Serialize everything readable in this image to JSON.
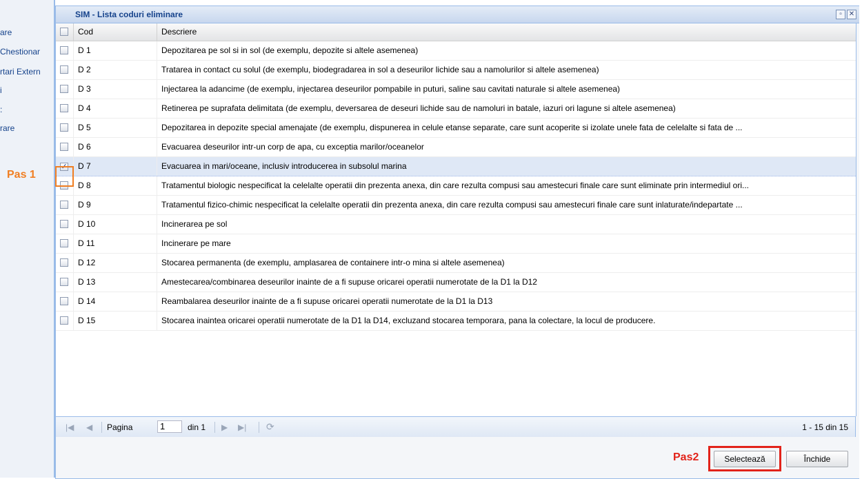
{
  "background": {
    "sidebar_items": [
      "are",
      "Chestionar",
      "rtari Extern",
      "i",
      ":",
      "rare"
    ]
  },
  "annotations": {
    "step1": "Pas 1",
    "step2": "Pas2",
    "step1_color": "#f07e22",
    "step2_color": "#e2231a"
  },
  "window": {
    "title": "SIM - Lista coduri eliminare",
    "tools": [
      "restore-icon",
      "close-icon"
    ]
  },
  "grid": {
    "columns": [
      "Cod",
      "Descriere"
    ],
    "rows": [
      {
        "cod": "D 1",
        "desc": "Depozitarea pe sol si in sol (de exemplu, depozite si altele asemenea)",
        "checked": false
      },
      {
        "cod": "D 2",
        "desc": "Tratarea in contact cu solul (de exemplu, biodegradarea in sol a deseurilor lichide sau a namolurilor si altele asemenea)",
        "checked": false
      },
      {
        "cod": "D 3",
        "desc": "Injectarea la adancime (de exemplu, injectarea deseurilor pompabile in puturi, saline sau cavitati naturale si altele asemenea)",
        "checked": false
      },
      {
        "cod": "D 4",
        "desc": "Retinerea pe suprafata delimitata (de exemplu, deversarea de deseuri lichide sau de namoluri in batale, iazuri ori lagune si altele asemenea)",
        "checked": false
      },
      {
        "cod": "D 5",
        "desc": "Depozitarea in depozite special amenajate (de exemplu, dispunerea in celule etanse separate, care sunt acoperite si izolate unele fata de celelalte si fata de ...",
        "checked": false
      },
      {
        "cod": "D 6",
        "desc": "Evacuarea deseurilor intr-un corp de apa, cu exceptia marilor/oceanelor",
        "checked": false
      },
      {
        "cod": "D 7",
        "desc": "Evacuarea in mari/oceane, inclusiv introducerea in subsolul marina",
        "checked": true
      },
      {
        "cod": "D 8",
        "desc": "Tratamentul biologic nespecificat la celelalte operatii din prezenta anexa, din care rezulta compusi sau amestecuri finale care sunt eliminate prin intermediul ori...",
        "checked": false
      },
      {
        "cod": "D 9",
        "desc": "Tratamentul fizico-chimic nespecificat la celelalte operatii din prezenta anexa, din care rezulta compusi sau amestecuri finale care sunt inlaturate/indepartate ...",
        "checked": false
      },
      {
        "cod": "D 10",
        "desc": "Incinerarea pe sol",
        "checked": false
      },
      {
        "cod": "D 11",
        "desc": "Incinerare pe mare",
        "checked": false
      },
      {
        "cod": "D 12",
        "desc": "Stocarea permanenta (de exemplu, amplasarea de containere intr-o mina si altele asemenea)",
        "checked": false
      },
      {
        "cod": "D 13",
        "desc": "Amestecarea/combinarea deseurilor inainte de a fi supuse oricarei operatii numerotate de la D1 la D12",
        "checked": false
      },
      {
        "cod": "D 14",
        "desc": "Reambalarea deseurilor inainte de a fi supuse oricarei operatii numerotate de la D1 la D13",
        "checked": false
      },
      {
        "cod": "D 15",
        "desc": "Stocarea inaintea oricarei operatii numerotate de la D1 la D14, excluzand stocarea temporara, pana la colectare, la locul de producere.",
        "checked": false
      }
    ]
  },
  "pager": {
    "page_label": "Pagina",
    "page_value": "1",
    "of_label": "din 1",
    "display_count": "1 - 15 din 15"
  },
  "footer": {
    "select_label": "Selectează",
    "close_label": "Închide"
  }
}
